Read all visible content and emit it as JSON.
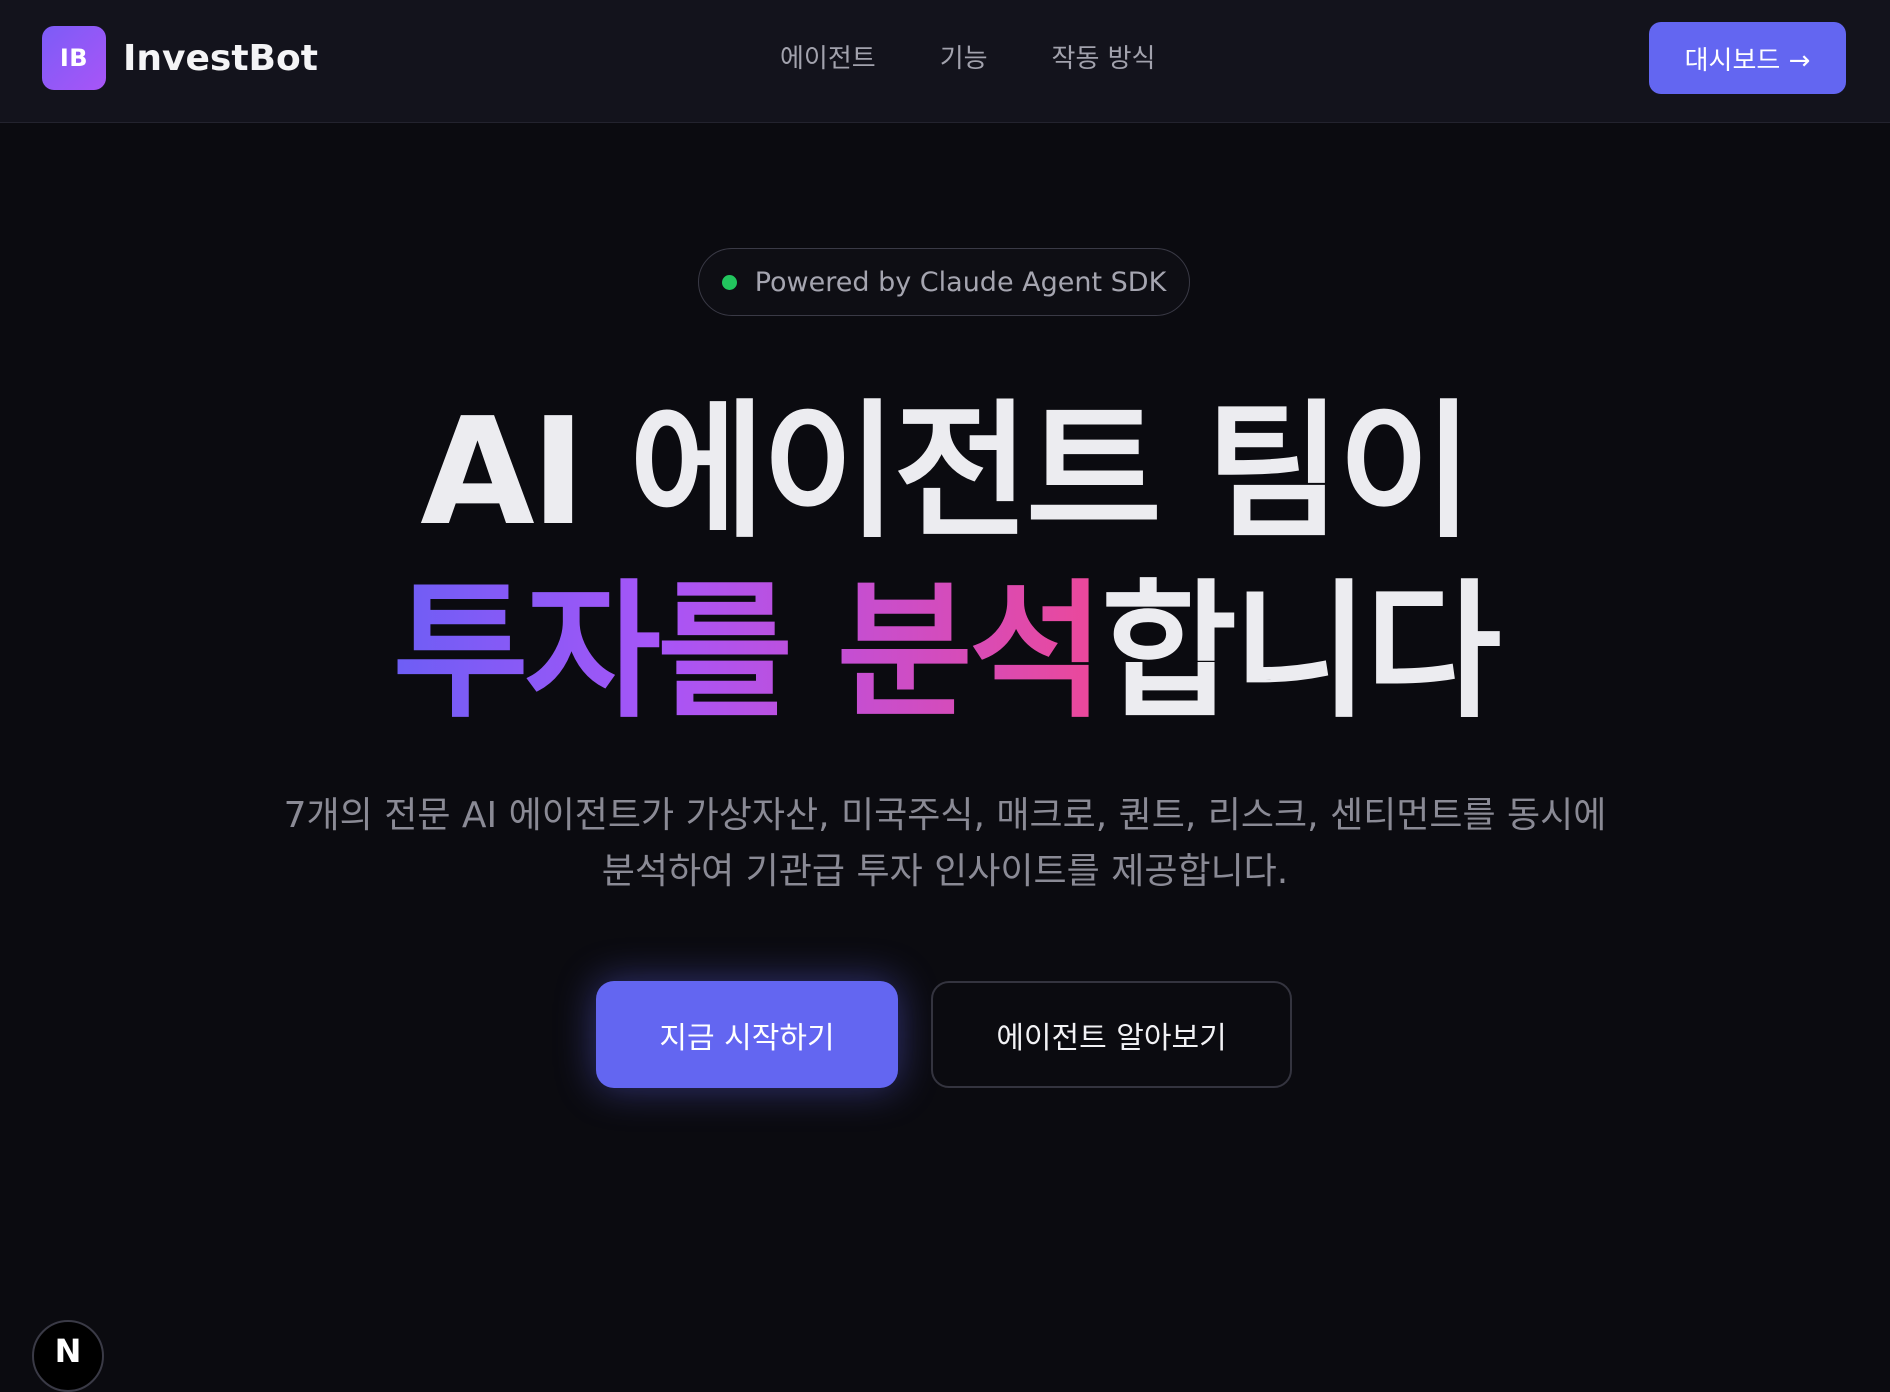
{
  "header": {
    "logo_text": "IB",
    "brand_name": "InvestBot",
    "nav_links": [
      "에이전트",
      "기능",
      "작동 방식"
    ],
    "dashboard_button": "대시보드 →"
  },
  "hero": {
    "badge_text": "Powered by Claude Agent SDK",
    "headline_line1": "AI 에이전트 팀이",
    "headline_line2_highlight": "투자를 분석",
    "headline_line2_rest": "합니다",
    "subtitle_line1": "7개의 전문 AI 에이전트가 가상자산, 미국주식, 매크로, 퀀트, 리스크, 센티먼트를 동시에",
    "subtitle_line2": "분석하여 기관급 투자 인사이트를 제공합니다.",
    "primary_button": "지금 시작하기",
    "secondary_button": "에이전트 알아보기"
  },
  "dev_badge": {
    "letter": "N"
  },
  "colors": {
    "background": "#0b0b10",
    "accent": "#6366f1",
    "status_dot": "#22c55e",
    "gradient_start": "#6d5ef5",
    "gradient_end": "#ec4899"
  }
}
